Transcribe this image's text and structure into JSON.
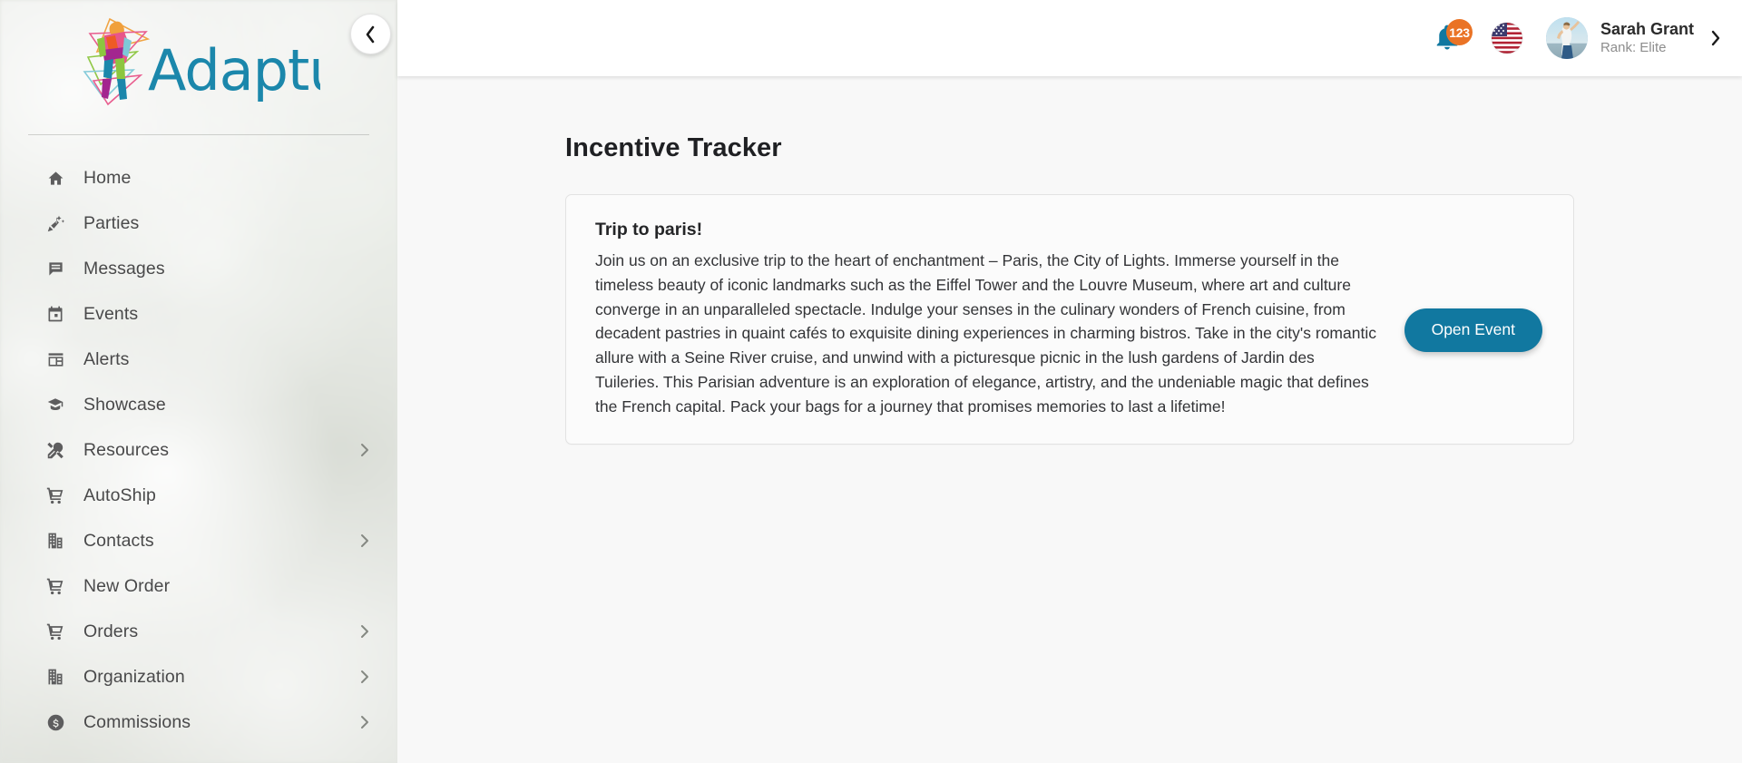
{
  "brand": {
    "name": "Adapture",
    "logo_colors": [
      "#1b87ab",
      "#e8568a",
      "#f0a03c",
      "#8cc63f",
      "#ee5b24",
      "#7ec8d8",
      "#a3268f"
    ]
  },
  "sidebar": {
    "collapse_button": {
      "icon": "chevron-left-icon"
    },
    "items": [
      {
        "label": "Home",
        "icon": "home-icon",
        "has_chevron": false
      },
      {
        "label": "Parties",
        "icon": "party-popper-icon",
        "has_chevron": false
      },
      {
        "label": "Messages",
        "icon": "message-icon",
        "has_chevron": false
      },
      {
        "label": "Events",
        "icon": "calendar-icon",
        "has_chevron": false
      },
      {
        "label": "Alerts",
        "icon": "alerts-panel-icon",
        "has_chevron": false
      },
      {
        "label": "Showcase",
        "icon": "graduation-cap-icon",
        "has_chevron": false
      },
      {
        "label": "Resources",
        "icon": "tools-icon",
        "has_chevron": true
      },
      {
        "label": "AutoShip",
        "icon": "cart-icon",
        "has_chevron": false
      },
      {
        "label": "Contacts",
        "icon": "building-icon",
        "has_chevron": true
      },
      {
        "label": "New Order",
        "icon": "cart-icon",
        "has_chevron": false
      },
      {
        "label": "Orders",
        "icon": "cart-icon",
        "has_chevron": true
      },
      {
        "label": "Organization",
        "icon": "building-icon",
        "has_chevron": true
      },
      {
        "label": "Commissions",
        "icon": "dollar-circle-icon",
        "has_chevron": true
      }
    ]
  },
  "topbar": {
    "notifications": {
      "icon": "bell-icon",
      "badge_count": "123",
      "badge_color": "#ea7325",
      "bell_color": "#1178a0"
    },
    "language": {
      "icon": "flag-us-icon",
      "label": "United States"
    },
    "user": {
      "avatar": "user-avatar",
      "name": "Sarah Grant",
      "rank": "Rank: Elite",
      "caret": "chevron-right-icon"
    }
  },
  "main": {
    "page_title": "Incentive Tracker",
    "card": {
      "title": "Trip to paris!",
      "description": "Join us on an exclusive trip to the heart of enchantment – Paris, the City of Lights. Immerse yourself in the timeless beauty of iconic landmarks such as the Eiffel Tower and the Louvre Museum, where art and culture converge in an unparalleled spectacle. Indulge your senses in the culinary wonders of French cuisine, from decadent pastries in quaint cafés to exquisite dining experiences in charming bistros. Take in the city's romantic allure with a Seine River cruise, and unwind with a picturesque picnic in the lush gardens of Jardin des Tuileries. This Parisian adventure is an exploration of elegance, artistry, and the undeniable magic that defines the French capital. Pack your bags for a journey that promises memories to last a lifetime!",
      "button_label": "Open Event",
      "button_color": "#1178a0"
    }
  }
}
